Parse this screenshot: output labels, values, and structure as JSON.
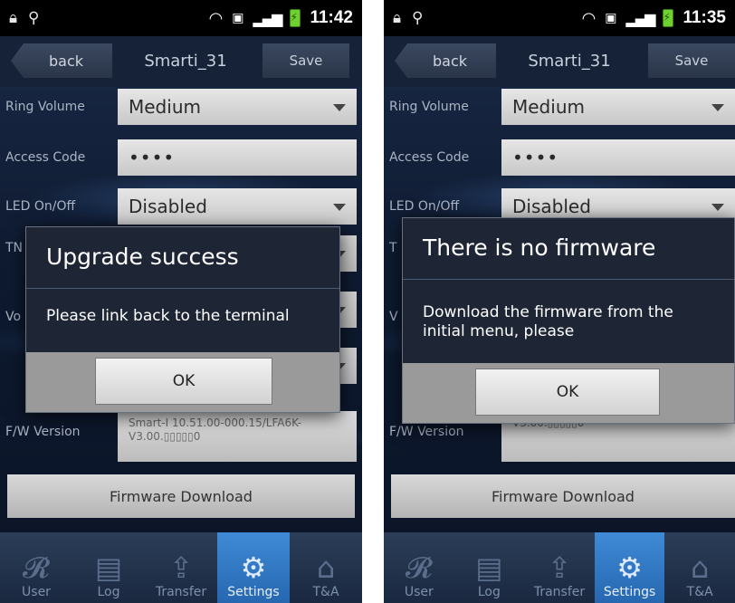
{
  "screens": [
    {
      "status": {
        "time": "11:42"
      },
      "header": {
        "back_label": "back",
        "title": "Smarti_31",
        "save_label": "Save"
      },
      "settings": {
        "ring_volume": {
          "label": "Ring Volume",
          "value": "Medium"
        },
        "access_code": {
          "label": "Access Code",
          "value": "••••"
        },
        "led": {
          "label": "LED On/Off",
          "value": "Disabled"
        },
        "partial_label_1": "TN",
        "partial_label_2": "Vo",
        "fw_version": {
          "label": "F/W Version",
          "value": "Smart-I 10.51.00-000.15/LFA6K-V3.00.▯▯▯▯▯0"
        }
      },
      "firmware_download_label": "Firmware Download",
      "dialog": {
        "title": "Upgrade success",
        "message": "Please link back to the terminal",
        "ok_label": "OK"
      },
      "tabs": [
        "User",
        "Log",
        "Transfer",
        "Settings",
        "T&A"
      ]
    },
    {
      "status": {
        "time": "11:35"
      },
      "header": {
        "back_label": "back",
        "title": "Smarti_31",
        "save_label": "Save"
      },
      "settings": {
        "ring_volume": {
          "label": "Ring Volume",
          "value": "Medium"
        },
        "access_code": {
          "label": "Access Code",
          "value": "••••"
        },
        "led": {
          "label": "LED On/Off",
          "value": "Disabled"
        },
        "partial_label_1": "T",
        "partial_label_2": "V",
        "fw_version": {
          "label": "F/W Version",
          "value": "V3.00.▯▯▯▯▯0"
        }
      },
      "firmware_download_label": "Firmware Download",
      "dialog": {
        "title": "There is no firmware",
        "message": "Download the firmware from the initial menu, please",
        "ok_label": "OK"
      },
      "tabs": [
        "User",
        "Log",
        "Transfer",
        "Settings",
        "T&A"
      ]
    }
  ],
  "active_tab": "Settings",
  "colors": {
    "active_tab": "#3f8ad6",
    "background": "#0e1a30",
    "dialog": "#1e2636"
  },
  "icons": {
    "status_left": [
      "lock-icon",
      "usb-icon"
    ],
    "status_right": [
      "wifi-icon",
      "sim-icon",
      "signal-icon",
      "battery-icon"
    ],
    "tabs": [
      "user-icon",
      "log-icon",
      "transfer-icon",
      "settings-gear-icon",
      "time-attendance-icon"
    ]
  }
}
